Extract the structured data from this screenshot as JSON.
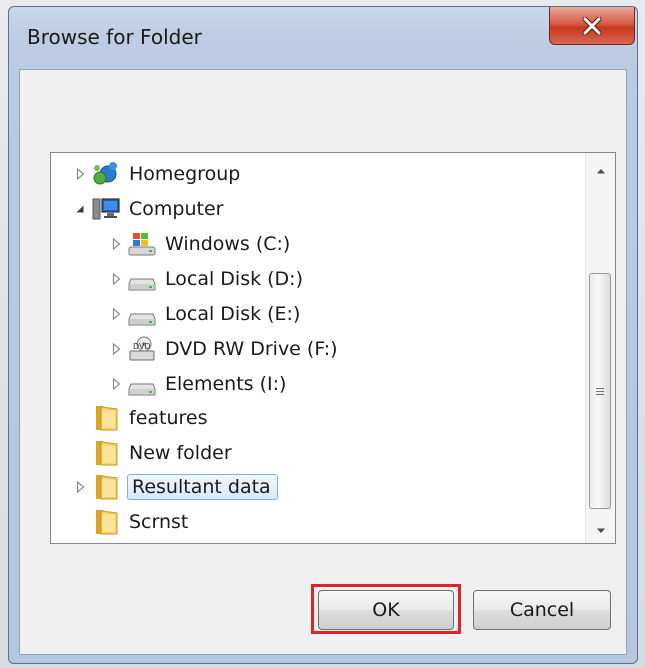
{
  "dialog": {
    "title": "Browse for Folder",
    "close_icon": "close-icon"
  },
  "tree": {
    "items": [
      {
        "label": "Homegroup",
        "icon": "homegroup-icon",
        "expander": "collapsed"
      },
      {
        "label": "Computer",
        "icon": "computer-icon",
        "expander": "expanded"
      },
      {
        "label": "Windows (C:)",
        "icon": "windows-drive-icon",
        "expander": "collapsed"
      },
      {
        "label": "Local Disk (D:)",
        "icon": "disk-drive-icon",
        "expander": "collapsed"
      },
      {
        "label": "Local Disk (E:)",
        "icon": "disk-drive-icon",
        "expander": "collapsed"
      },
      {
        "label": "DVD RW Drive (F:)",
        "icon": "dvd-drive-icon",
        "expander": "collapsed"
      },
      {
        "label": "Elements (I:)",
        "icon": "disk-drive-icon",
        "expander": "collapsed"
      },
      {
        "label": "features",
        "icon": "folder-icon",
        "expander": "none"
      },
      {
        "label": "New folder",
        "icon": "folder-icon",
        "expander": "none"
      },
      {
        "label": "Resultant data",
        "icon": "folder-icon",
        "expander": "collapsed",
        "selected": true
      },
      {
        "label": "Scrnst",
        "icon": "folder-icon",
        "expander": "none"
      }
    ]
  },
  "buttons": {
    "ok_label": "OK",
    "cancel_label": "Cancel"
  },
  "colors": {
    "highlight_border": "#d9262c",
    "selection_fill": "#d6e9fc",
    "close_button": "#c6391f"
  }
}
